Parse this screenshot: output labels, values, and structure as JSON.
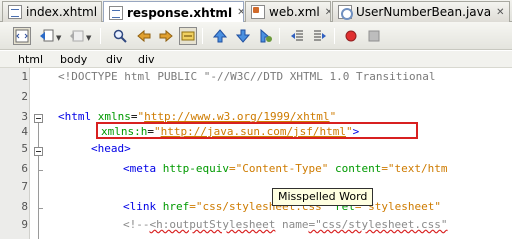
{
  "tabs": [
    {
      "label": "index.xhtml",
      "icon": "xhtml-file-icon",
      "active": false
    },
    {
      "label": "response.xhtml",
      "icon": "xhtml-file-icon",
      "active": true
    },
    {
      "label": "web.xml",
      "icon": "xml-file-icon",
      "active": false
    },
    {
      "label": "UserNumberBean.java",
      "icon": "java-file-icon",
      "active": false
    }
  ],
  "breadcrumbs": [
    "html",
    "body",
    "div",
    "div"
  ],
  "editor": {
    "line_numbers": [
      "1",
      "2",
      "3",
      "4",
      "5",
      "6",
      "7",
      "8",
      "9"
    ],
    "line1": {
      "text": "<!DOCTYPE html PUBLIC \"-//W3C//DTD XHTML 1.0 Transitional"
    },
    "line3": {
      "open": "<html ",
      "attr": "xmlns",
      "eq": "=",
      "quote_open": "\"",
      "url": "http://www.w3.org/1999/xhtml",
      "quote_close": "\""
    },
    "line4": {
      "attr": "xmlns:h",
      "eq": "=",
      "quote_open": "\"",
      "url": "http://java.sun.com/jsf/html",
      "quote_close": "\"",
      "close": ">"
    },
    "line5": {
      "tag": "<head>"
    },
    "line6": {
      "open": "<meta ",
      "attr1": "http-equiv",
      "val1": "=\"Content-Type\"",
      "attr2": " content",
      "val2": "=\"text/htm"
    },
    "line8": {
      "open": "<link ",
      "attr1": "href",
      "val1": "=\"css/sty",
      "hidden_part": "lesheet.css\"",
      "attr2": " rel",
      "val2": "=\"stylesheet\""
    },
    "line9": {
      "comment_start": "<!--",
      "tag": "<h:outputStylesheet",
      "attr": " name",
      "val": "=\"css/stylesheet.css\""
    }
  },
  "tooltip": {
    "text": "Misspelled Word"
  }
}
